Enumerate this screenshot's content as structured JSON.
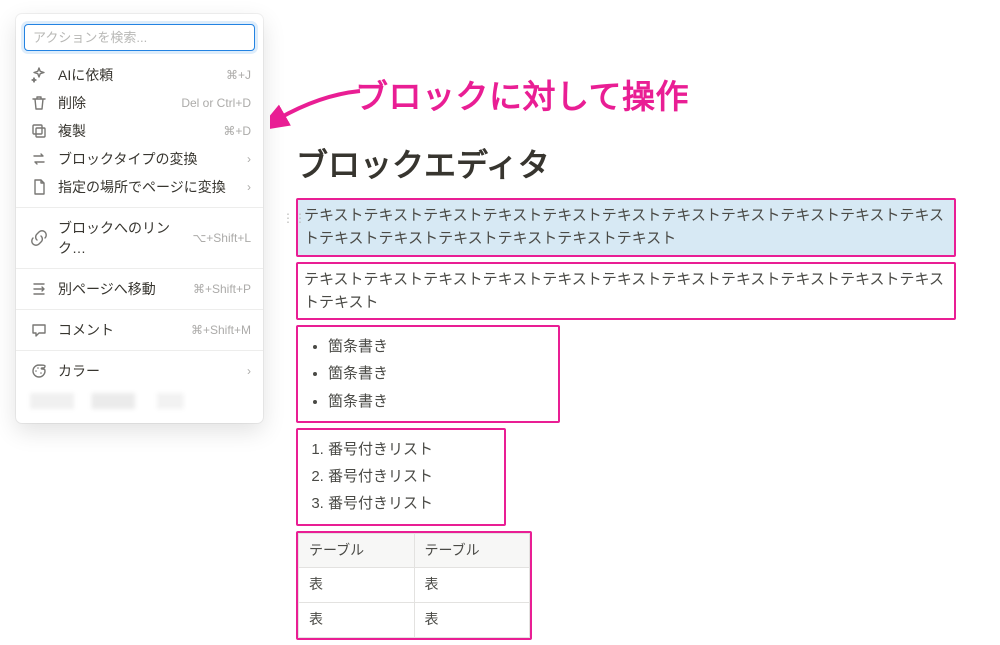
{
  "menu": {
    "search_placeholder": "アクションを検索...",
    "items": [
      {
        "label": "AIに依頼",
        "shortcut": "⌘+J",
        "icon": "sparkle"
      },
      {
        "label": "削除",
        "shortcut": "Del or Ctrl+D",
        "icon": "trash"
      },
      {
        "label": "複製",
        "shortcut": "⌘+D",
        "icon": "duplicate"
      },
      {
        "label": "ブロックタイプの変換",
        "shortcut": "",
        "has_submenu": true,
        "icon": "swap"
      },
      {
        "label": "指定の場所でページに変換",
        "shortcut": "",
        "has_submenu": true,
        "icon": "page"
      }
    ],
    "items2": [
      {
        "label": "ブロックへのリンク…",
        "shortcut": "⌥+Shift+L",
        "icon": "link"
      }
    ],
    "items3": [
      {
        "label": "別ページへ移動",
        "shortcut": "⌘+Shift+P",
        "icon": "move"
      }
    ],
    "items4": [
      {
        "label": "コメント",
        "shortcut": "⌘+Shift+M",
        "icon": "comment"
      }
    ],
    "items5": [
      {
        "label": "カラー",
        "shortcut": "",
        "has_submenu": true,
        "icon": "palette"
      }
    ]
  },
  "annotation": {
    "label": "ブロックに対して操作"
  },
  "content": {
    "title": "ブロックエディタ",
    "para1": "テキストテキストテキストテキストテキストテキストテキストテキストテキストテキストテキストテキストテキストテキストテキストテキストテキスト",
    "para2": "テキストテキストテキストテキストテキストテキストテキストテキストテキストテキストテキストテキスト",
    "bullets": [
      "箇条書き",
      "箇条書き",
      "箇条書き"
    ],
    "numbers": [
      "番号付きリスト",
      "番号付きリスト",
      "番号付きリスト"
    ],
    "table": {
      "headers": [
        "テーブル",
        "テーブル"
      ],
      "rows": [
        [
          "表",
          "表"
        ],
        [
          "表",
          "表"
        ]
      ]
    }
  }
}
